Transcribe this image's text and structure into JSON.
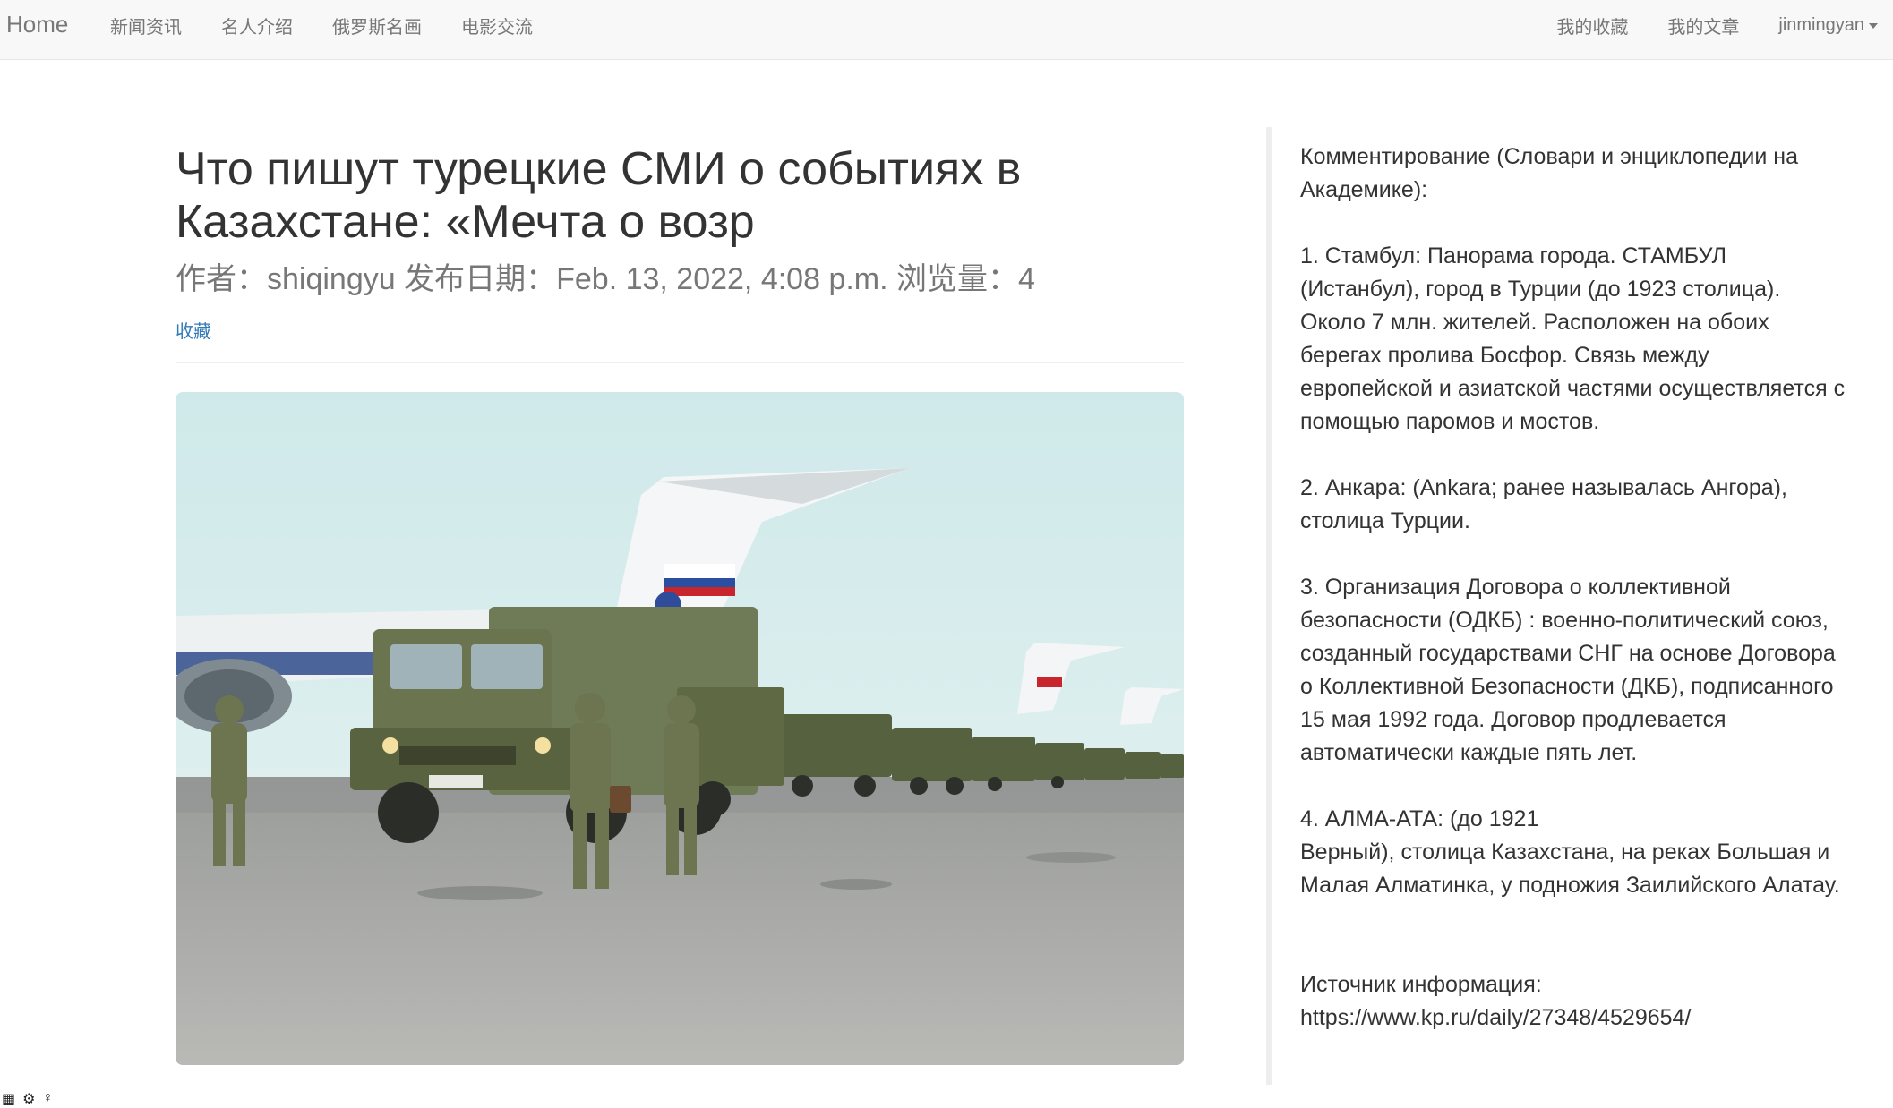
{
  "nav": {
    "brand": "Home",
    "left_links": [
      "新闻资讯",
      "名人介绍",
      "俄罗斯名画",
      "电影交流"
    ],
    "right_links": [
      "我的收藏",
      "我的文章"
    ],
    "user": "jinmingyan"
  },
  "article": {
    "title": "Что пишут турецкие СМИ о событиях в Казахстане: «Мечта о возр",
    "author_label": "作者：",
    "author": "shiqingyu",
    "date_label": "发布日期：",
    "date": "Feb. 13, 2022, 4:08 p.m.",
    "views_label": "浏览量：",
    "views": "4",
    "favorite": "收藏"
  },
  "sidebar": {
    "heading": "Комментирование (Словари и энциклопедии на Академике):",
    "notes": [
      "1. Стамбул: Панорама города. СТАМБУЛ (Истанбул), город в Турции (до 1923 столица). Около 7 млн. жителей. Расположен на обоих берегах пролива Босфор. Связь между европейской и азиатской частями осуществляется с помощью паромов и мостов.",
      "2. Анкара: (Ankara; ранее называлась Ангора), столица Турции.",
      "3. Организация Договора о коллективной безопасности (ОДКБ) : военно-политический союз, созданный государствами СНГ на основе Договора о Коллективной Безопасности (ДКБ), подписанного 15 мая 1992 года. Договор продлевается автоматически каждые пять лет."
    ],
    "note4_line1": "4. АЛМА-АТА: (до 1921",
    "note4_rest": "Верный), столица Казахстана, на реках Большая и Малая Алматинка, у подножия Заилийского Алатау.",
    "source_label": "Источник информация:",
    "source_url": "https://www.kp.ru/daily/27348/4529654/"
  },
  "icons": [
    "grid-icon",
    "gear-icon",
    "person-icon"
  ]
}
